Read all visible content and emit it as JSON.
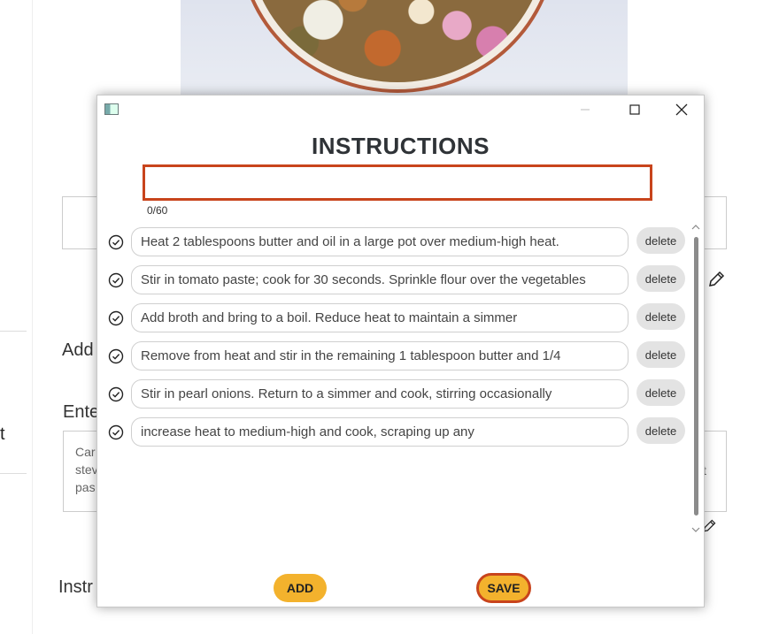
{
  "background": {
    "partial_t": "t",
    "add_label": "Add",
    "enter_label": "Ente",
    "instr_label": "Instr",
    "textarea_lines": [
      "Car",
      "stev",
      "pas"
    ],
    "textarea_right_char": "t"
  },
  "dialog": {
    "heading": "INSTRUCTIONS",
    "input": {
      "value": "",
      "placeholder": ""
    },
    "counter": "0/60",
    "steps": [
      {
        "text": "Heat 2 tablespoons butter and oil in a large pot over medium-high heat.",
        "delete_label": "delete"
      },
      {
        "text": "Stir in tomato paste; cook for 30 seconds. Sprinkle flour over the vegetables",
        "delete_label": "delete"
      },
      {
        "text": "Add broth and bring to a boil. Reduce heat to maintain a simmer",
        "delete_label": "delete"
      },
      {
        "text": "Remove from heat and stir in the remaining 1 tablespoon butter and 1/4",
        "delete_label": "delete"
      },
      {
        "text": "Stir in pearl onions. Return to a simmer and cook, stirring occasionally",
        "delete_label": "delete"
      },
      {
        "text": "increase heat to medium-high and cook, scraping up any",
        "delete_label": "delete"
      }
    ],
    "add_button": "ADD",
    "save_button": "SAVE"
  },
  "colors": {
    "accent_button": "#f3b22d",
    "focus_border": "#c8441c",
    "heading": "#2f3337"
  },
  "icons": [
    "app-icon",
    "minimize-icon",
    "maximize-icon",
    "close-icon",
    "check-circle-icon",
    "chevron-up-icon",
    "chevron-down-icon",
    "pencil-icon"
  ]
}
